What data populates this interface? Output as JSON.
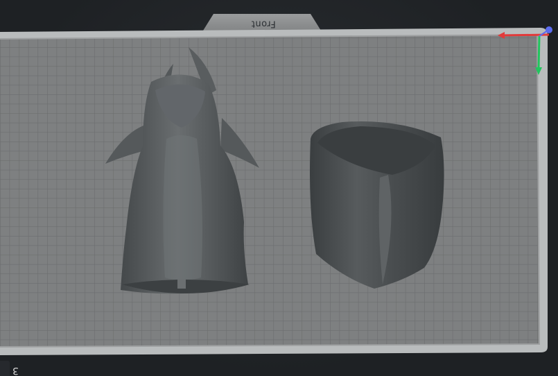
{
  "viewport": {
    "plate_label": "Front",
    "bottom_left_text": "3"
  },
  "axes": {
    "x_color": "#e23b3b",
    "y_color": "#22c55e",
    "z_color": "#5b6cf0"
  },
  "objects": [
    {
      "name": "head-bust"
    },
    {
      "name": "body-base"
    }
  ],
  "colors": {
    "plate": "#7f8182",
    "plate_grid": "#6e7071",
    "plate_border": "#c2c5c6",
    "background": "#1e2124",
    "model": "#565a5c"
  }
}
